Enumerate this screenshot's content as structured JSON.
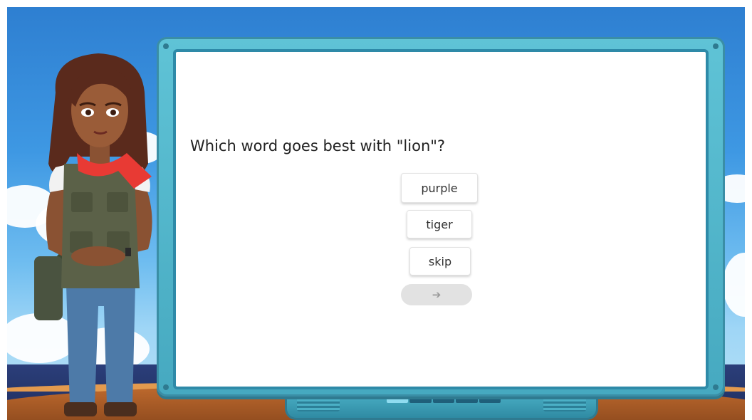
{
  "question": {
    "text": "Which word goes best with \"lion\"?"
  },
  "choices": [
    {
      "label": "purple"
    },
    {
      "label": "tiger"
    },
    {
      "label": "skip"
    }
  ],
  "next_button": {
    "icon": "arrow-right-icon",
    "glyph": "➔"
  },
  "progress": {
    "segments": 5,
    "active_index": 0
  },
  "colors": {
    "sky": "#3e98e3",
    "board_frame": "#5fc3d6",
    "board_border": "#2e8aa8",
    "next_button_disabled": "#e2e2e2",
    "scarf": "#e83a34"
  }
}
